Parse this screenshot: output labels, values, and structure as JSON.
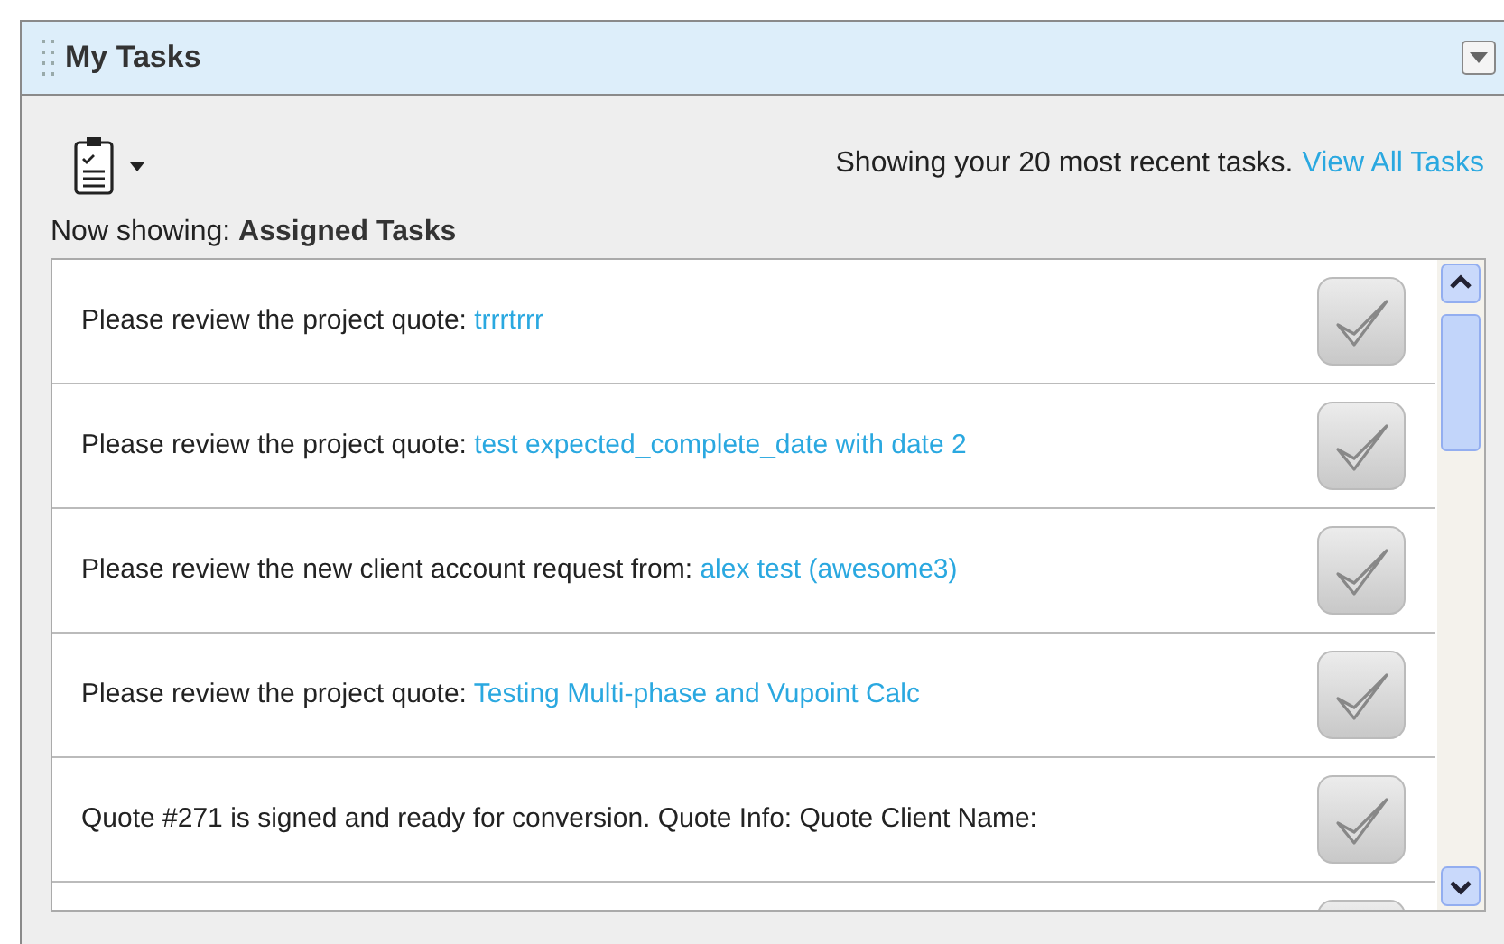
{
  "panel": {
    "title": "My Tasks"
  },
  "summary": {
    "text": "Showing your 20 most recent tasks.",
    "link": "View All Tasks"
  },
  "now_showing": "Now showing: **Assigned Tasks**",
  "tasks": [
    {
      "kind": "task",
      "text": "Please review the project quote:",
      "link": "trrrtrrr"
    },
    {
      "kind": "task",
      "text": "Please review the project quote:",
      "link": "test expected_complete_date with date 2"
    },
    {
      "kind": "task",
      "text": "Please review the new client account request from:",
      "link": "alex test (awesome3)"
    },
    {
      "kind": "task",
      "text": "Please review the project quote:",
      "link": "Testing Multi-phase and Vupoint Calc"
    },
    {
      "kind": "task",
      "text": "Quote #271 is signed and ready for conversion. Quote Info: Quote Client Name:"
    },
    {
      "kind": "partial"
    }
  ]
}
